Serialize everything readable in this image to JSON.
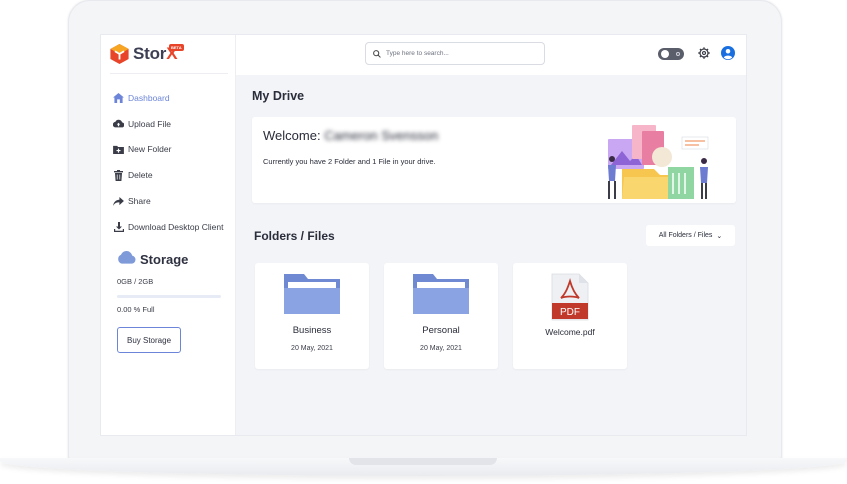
{
  "app": {
    "logo_text": "Stor",
    "logo_x": "X",
    "logo_badge": "BETA"
  },
  "search": {
    "placeholder": "Type here to search..."
  },
  "sidebar": {
    "items": [
      {
        "label": "Dashboard",
        "icon": "home-icon",
        "active": true
      },
      {
        "label": "Upload File",
        "icon": "cloud-upload-icon"
      },
      {
        "label": "New Folder",
        "icon": "folder-plus-icon"
      },
      {
        "label": "Delete",
        "icon": "trash-icon"
      },
      {
        "label": "Share",
        "icon": "share-icon"
      },
      {
        "label": "Download Desktop Client",
        "icon": "download-icon"
      }
    ],
    "storage": {
      "title": "Storage",
      "used": "0GB / 2GB",
      "percent_text": "0.00 % Full",
      "percent_value": 0,
      "buy_label": "Buy Storage"
    }
  },
  "main": {
    "title": "My Drive",
    "welcome": {
      "greeting": "Welcome:",
      "name": "Cameron Svensson",
      "subtitle": "Currently you have 2 Folder and 1 File in your drive."
    },
    "section_title": "Folders / Files",
    "filter_label": "All Folders / Files",
    "items": [
      {
        "type": "folder",
        "name": "Business",
        "date": "20 May, 2021"
      },
      {
        "type": "folder",
        "name": "Personal",
        "date": "20 May, 2021"
      },
      {
        "type": "pdf",
        "name": "Welcome.pdf",
        "icon_text": "PDF"
      }
    ]
  },
  "colors": {
    "accent": "#6c85d8",
    "brand_orange": "#e8442a",
    "pdf_red": "#c0392b",
    "folder_blue": "#7f9ad9"
  }
}
